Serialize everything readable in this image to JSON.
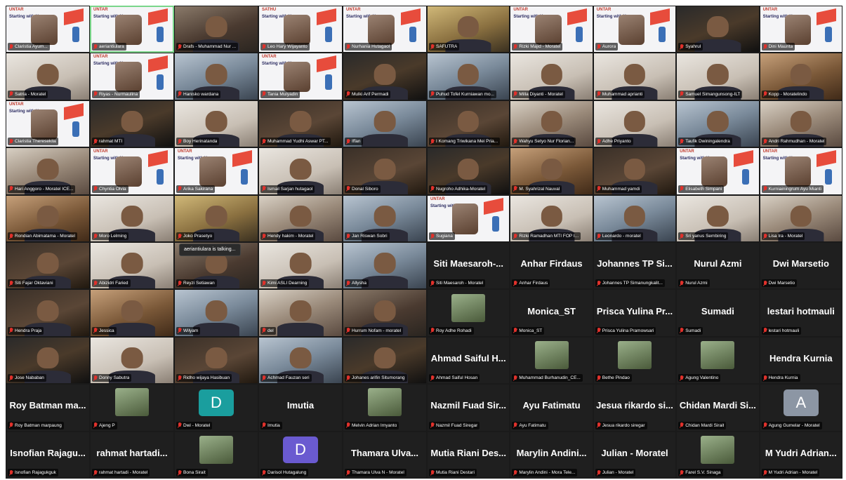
{
  "colors": {
    "active_speaker_border": "#7ad68a",
    "muted_icon": "#e0312b",
    "grid_background": "#1a1a1a",
    "avatar_teal": "#1a9e9e",
    "avatar_purple": "#6a5ad0",
    "avatar_gray": "#8c96a4"
  },
  "speaking_tooltip": "aeriantiulara is talking...",
  "left_panel": {
    "tiles": [
      {
        "kind": "slide",
        "name": "Claristia Ayum...",
        "brand": "UNTAR",
        "title": "Starting with You"
      },
      {
        "kind": "slide",
        "name": "aeriantiulara",
        "brand": "UNTAR",
        "title": "Starting with You",
        "active": true
      },
      {
        "kind": "video",
        "name": "Drafs - Muhammad Nur ...",
        "tone": "t0"
      },
      {
        "kind": "slide",
        "name": "Leo Hary Wijayanto",
        "brand": "SATHU",
        "title": "Starting with You"
      },
      {
        "kind": "slide",
        "name": "Nurhania Hutagaol",
        "brand": "UNTAR",
        "title": "Starting with You"
      },
      {
        "kind": "video",
        "name": "Satria - Moratel",
        "tone": "t5"
      },
      {
        "kind": "slide",
        "name": "Riyas - Nurmaulina",
        "brand": "UNTAR",
        "title": "Starting with You"
      },
      {
        "kind": "video",
        "name": "Hanisko wardana",
        "tone": "t3"
      },
      {
        "kind": "slide",
        "name": "Tania Mulyadin",
        "brand": "UNTAR",
        "title": "Starting with You"
      },
      {
        "kind": "video",
        "name": "Mulki Arif Permadi",
        "tone": "t6"
      },
      {
        "kind": "slide",
        "name": "Claristia Theresekila",
        "brand": "UNTAR",
        "title": "Starting with You"
      },
      {
        "kind": "video",
        "name": "rahmat MTI",
        "tone": "t6"
      },
      {
        "kind": "video",
        "name": "Boy Herinatanda",
        "tone": "t5"
      },
      {
        "kind": "video",
        "name": "Muhammad Yudhi Aswar PT...",
        "tone": "t2"
      },
      {
        "kind": "video",
        "name": "Iffan",
        "tone": "t3"
      },
      {
        "kind": "video",
        "name": "Hari Anggoro - Moratel ICE...",
        "tone": "t1"
      },
      {
        "kind": "slide",
        "name": "Chyntia Olvia",
        "brand": "UNTAR",
        "title": "Starting with You"
      },
      {
        "kind": "slide",
        "name": "Arika Sakirana",
        "brand": "UNTAR",
        "title": "Starting with You"
      },
      {
        "kind": "video",
        "name": "Ismail Sarjan hutagaol",
        "tone": "t5"
      },
      {
        "kind": "video",
        "name": "Donal Siboro",
        "tone": "t2"
      },
      {
        "kind": "video",
        "name": "Rondian Abimatama - Moratel",
        "tone": "t4"
      },
      {
        "kind": "video",
        "name": "Moro Lelming",
        "tone": "t5"
      },
      {
        "kind": "video",
        "name": "Joko Prasetyo",
        "tone": "t7"
      },
      {
        "kind": "video",
        "name": "Hendy hakim - Moratel",
        "tone": "t1"
      },
      {
        "kind": "video",
        "name": "Jan Riswan Sobri",
        "tone": "t3"
      },
      {
        "kind": "video",
        "name": "Siti Fajar Oktaviani",
        "tone": "t2"
      },
      {
        "kind": "video",
        "name": "Abizidri Faried",
        "tone": "t5"
      },
      {
        "kind": "video",
        "name": "Reyzi Setiawan",
        "tone": "t0"
      },
      {
        "kind": "video",
        "name": "Kimi ASLI Dearning",
        "tone": "t5"
      },
      {
        "kind": "video",
        "name": "Allysha",
        "tone": "t3"
      },
      {
        "kind": "video",
        "name": "Hendra Praja",
        "tone": "t2"
      },
      {
        "kind": "video",
        "name": "Jessica",
        "tone": "t4"
      },
      {
        "kind": "video",
        "name": "Wilyam",
        "tone": "t3"
      },
      {
        "kind": "video",
        "name": "del",
        "tone": "t1"
      },
      {
        "kind": "video",
        "name": "Hurrum Nofam - moratel",
        "tone": "t0"
      },
      {
        "kind": "video",
        "name": "Jose Nababan",
        "tone": "t6"
      },
      {
        "kind": "video",
        "name": "Donny Sabutra",
        "tone": "t5"
      },
      {
        "kind": "video",
        "name": "Ridho wijaya Hasibuan",
        "tone": "t2"
      },
      {
        "kind": "video",
        "name": "Achmad Fauzan seri",
        "tone": "t3"
      },
      {
        "kind": "video",
        "name": "Johanes arifin Situmorang",
        "tone": "t6"
      },
      {
        "kind": "name",
        "name": "Roy Batman marpaung",
        "big": "Roy Batman ma..."
      },
      {
        "kind": "pic",
        "name": "Ajeng P"
      },
      {
        "kind": "letter",
        "name": "Dwi - Moratel",
        "letter": "D",
        "color": "#1a9e9e"
      },
      {
        "kind": "name",
        "name": "Imutia",
        "big": "Imutia"
      },
      {
        "kind": "pic",
        "name": "Melvin Adrian Irnyanto"
      },
      {
        "kind": "name",
        "name": "Isnofian Rajagukguk",
        "big": "Isnofian Rajagu..."
      },
      {
        "kind": "name",
        "name": "rahmat hartadi - Moratel",
        "big": "rahmat hartadi..."
      },
      {
        "kind": "pic",
        "name": "Bona Sirait"
      },
      {
        "kind": "letter",
        "name": "Darisol Hutagalung",
        "letter": "D",
        "color": "#6a5ad0"
      },
      {
        "kind": "name",
        "name": "Thamara Ulva N - Moratel",
        "big": "Thamara Ulva..."
      }
    ]
  },
  "right_panel": {
    "tiles": [
      {
        "kind": "video",
        "name": "SAFUTRA",
        "tone": "t7"
      },
      {
        "kind": "slide",
        "name": "Rizki Majid - Moratel",
        "brand": "UNTAR",
        "title": "Starting with You"
      },
      {
        "kind": "slide",
        "name": "Aurora",
        "brand": "UNTAR",
        "title": "Starting with You"
      },
      {
        "kind": "video",
        "name": "Syahrul",
        "tone": "t6"
      },
      {
        "kind": "slide",
        "name": "Dini Maurita",
        "brand": "UNTAR",
        "title": "Starting with You"
      },
      {
        "kind": "video",
        "name": "Puhud Tofel Kurniawan mo...",
        "tone": "t3"
      },
      {
        "kind": "video",
        "name": "Milla Diyanti - Moratel",
        "tone": "t5"
      },
      {
        "kind": "video",
        "name": "Muhammad aprianti",
        "tone": "t5"
      },
      {
        "kind": "video",
        "name": "Samuel Simangunsong-ILT",
        "tone": "t5"
      },
      {
        "kind": "video",
        "name": "Kopp - Moratelindo",
        "tone": "t4"
      },
      {
        "kind": "video",
        "name": "I Komang Triwikana Mei Pria...",
        "tone": "t2"
      },
      {
        "kind": "video",
        "name": "Wahyu Setyo Nur Florian...",
        "tone": "t1"
      },
      {
        "kind": "video",
        "name": "Adhe Priyanto",
        "tone": "t5"
      },
      {
        "kind": "video",
        "name": "Taufik Dwiningalendra",
        "tone": "t3"
      },
      {
        "kind": "video",
        "name": "Andri Rahmudhan - Moratel",
        "tone": "t1"
      },
      {
        "kind": "video",
        "name": "Nugroho Adhika-Moratel",
        "tone": "t6"
      },
      {
        "kind": "video",
        "name": "M. Syahrizal Nauval",
        "tone": "t4"
      },
      {
        "kind": "video",
        "name": "Muhammad yamdi",
        "tone": "t2"
      },
      {
        "kind": "slide",
        "name": "Elisabeth Simpani",
        "brand": "UNTAR",
        "title": "Starting with You"
      },
      {
        "kind": "slide",
        "name": "Kurniainingrum Ayu Mianti",
        "brand": "UNTAR",
        "title": "Starting with You"
      },
      {
        "kind": "slide",
        "name": "Sugiana",
        "brand": "UNTAR",
        "title": "Starting with You"
      },
      {
        "kind": "video",
        "name": "Rizki Ramadhan MTI FOP I...",
        "tone": "t5"
      },
      {
        "kind": "video",
        "name": "Leonardo - moratel",
        "tone": "t3"
      },
      {
        "kind": "video",
        "name": "Sri yanus Sembiring",
        "tone": "t5"
      },
      {
        "kind": "video",
        "name": "Lisa Ira - Moratel",
        "tone": "t1"
      },
      {
        "kind": "name",
        "name": "Siti Maesaroh - Moratel",
        "big": "Siti Maesaroh-..."
      },
      {
        "kind": "name",
        "name": "Anhar Firdaus",
        "big": "Anhar Firdaus"
      },
      {
        "kind": "name",
        "name": "Johannes TP Simanungkalit...",
        "big": "Johannes TP Si..."
      },
      {
        "kind": "name",
        "name": "Nurul Azmi",
        "big": "Nurul Azmi"
      },
      {
        "kind": "name",
        "name": "Dwi Marsetio",
        "big": "Dwi Marsetio"
      },
      {
        "kind": "pic",
        "name": "Roy Adhe Rohadi"
      },
      {
        "kind": "name",
        "name": "Monica_ST",
        "big": "Monica_ST"
      },
      {
        "kind": "name",
        "name": "Prisca Yulina Pramowsari",
        "big": "Prisca Yulina Pr..."
      },
      {
        "kind": "name",
        "name": "Sumadi",
        "big": "Sumadi"
      },
      {
        "kind": "name",
        "name": "lestari hotmauli",
        "big": "lestari hotmauli"
      },
      {
        "kind": "name",
        "name": "Ahmad Saiful Hosan",
        "big": "Ahmad Saiful H..."
      },
      {
        "kind": "pic",
        "name": "Muhammad Burhanudin_CE..."
      },
      {
        "kind": "pic",
        "name": "Bethe Pindao"
      },
      {
        "kind": "pic",
        "name": "Agung Valentino"
      },
      {
        "kind": "name",
        "name": "Hendra Kurnia",
        "big": "Hendra Kurnia"
      },
      {
        "kind": "name",
        "name": "Nazmil Fuad Siregar",
        "big": "Nazmil Fuad Sir..."
      },
      {
        "kind": "name",
        "name": "Ayu Fatimatu",
        "big": "Ayu Fatimatu"
      },
      {
        "kind": "name",
        "name": "Jesua rikardo siregar",
        "big": "Jesua rikardo si..."
      },
      {
        "kind": "name",
        "name": "Chidan Mardi Sirait",
        "big": "Chidan Mardi Si..."
      },
      {
        "kind": "letter",
        "name": "Agung Gumelar - Moratel",
        "letter": "A",
        "color": "#8c96a4"
      },
      {
        "kind": "name",
        "name": "Mutia Riani Destari",
        "big": "Mutia Riani Des..."
      },
      {
        "kind": "name",
        "name": "Marylin Andini - Mora Tele...",
        "big": "Marylin Andini..."
      },
      {
        "kind": "name",
        "name": "Julian - Moratel",
        "big": "Julian - Moratel"
      },
      {
        "kind": "pic",
        "name": "Farel S.V. Sinaga"
      },
      {
        "kind": "name",
        "name": "M Yudri Adrian - Moratel",
        "big": "M Yudri Adrian..."
      }
    ]
  }
}
